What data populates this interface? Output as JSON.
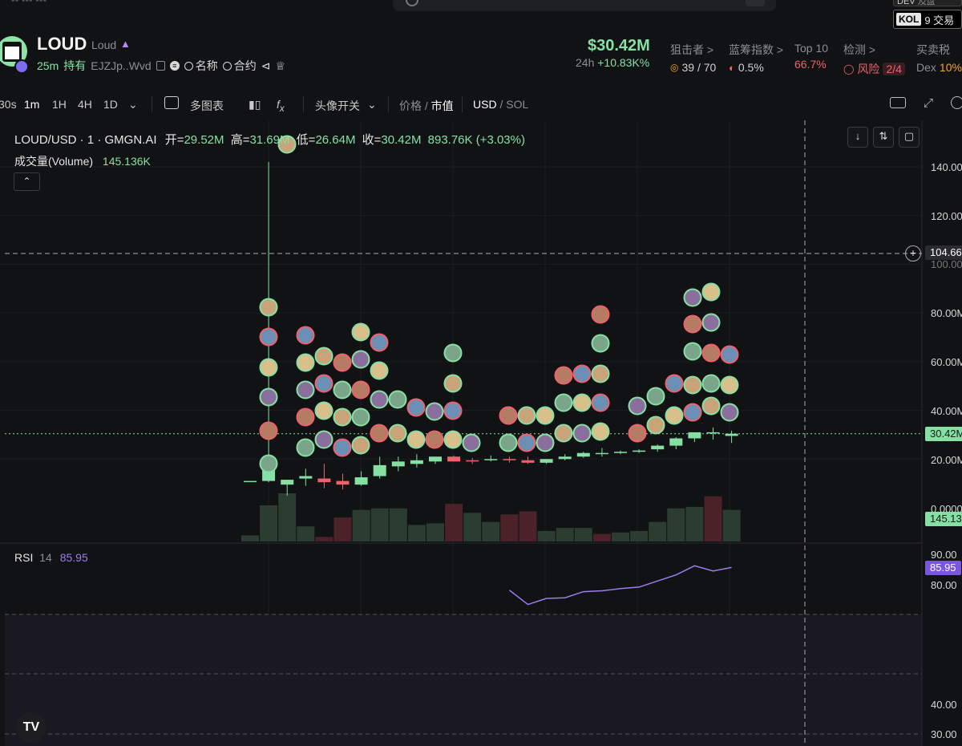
{
  "topbar": {
    "dev_label": "DEV",
    "dev_value": "及盘",
    "kol_label": "KOL",
    "kol_value": "9 交易"
  },
  "token": {
    "symbol": "LOUD",
    "name": "Loud",
    "age": "25m",
    "hold_label": "持有",
    "address": "EJZJp..Wvd",
    "name_search": "名称",
    "contract_search": "合约"
  },
  "market": {
    "price": "$30.42M",
    "period": "24h",
    "change": "+10.83K%"
  },
  "stats": [
    {
      "label": "狙击者 >",
      "value": "39 / 70",
      "color": "#d0d0d0",
      "icon": "sniper-icon"
    },
    {
      "label": "蓝筹指数 >",
      "value": "0.5%",
      "color": "#d0d0d0",
      "icon": "gauge-icon"
    },
    {
      "label": "Top 10",
      "value": "66.7%",
      "color": "#f0616d"
    },
    {
      "label": "检测 >",
      "value": "风险",
      "extra": "2/4",
      "color": "#f0616d",
      "icon": "shield-icon"
    },
    {
      "label": "买卖税",
      "value": "Dex",
      "extra": "10%",
      "color": "#8b8e94"
    }
  ],
  "toolbar": {
    "intervals": [
      "30s",
      "1m",
      "1H",
      "4H",
      "1D"
    ],
    "active_interval": "1m",
    "multi_chart": "多图表",
    "avatar_toggle": "头像开关",
    "price_label": "价格",
    "mcap_label": "市值",
    "usd_label": "USD",
    "sol_label": "SOL"
  },
  "legend": {
    "pair": "LOUD/USD · 1 · GMGN.AI",
    "open_label": "开=",
    "open": "29.52M",
    "high_label": "高=",
    "high": "31.69M",
    "low_label": "低=",
    "low": "26.64M",
    "close_label": "收=",
    "close": "30.42M",
    "change": "893.76K (+3.03%)",
    "volume_label": "成交量(Volume)",
    "volume": "145.136K",
    "rsi_label": "RSI",
    "rsi_period": "14",
    "rsi_value": "85.95"
  },
  "axis": {
    "price_ticks": [
      "140.00M",
      "120.00M",
      "100.00M",
      "80.00M",
      "60.00M",
      "40.00M",
      "20.00M",
      "0.0000"
    ],
    "crosshair_value": "104.66",
    "current_price_tag": "30.42M",
    "volume_tag": "145.13",
    "rsi_ticks": [
      "90.00",
      "80.00",
      "40.00",
      "30.00"
    ],
    "rsi_tag": "85.95"
  },
  "colors": {
    "up": "#86e0a4",
    "down": "#f0616d",
    "rsi": "#9d7cf0",
    "background": "#111214"
  },
  "chart_data": {
    "type": "candlestick",
    "title": "LOUD/USD · 1 · GMGN.AI",
    "unit": "M",
    "candles": [
      {
        "o": 11.0,
        "h": 11.0,
        "l": 11.0,
        "c": 11.0
      },
      {
        "o": 11.0,
        "h": 142.0,
        "l": 10.5,
        "c": 20.5
      },
      {
        "o": 9.5,
        "h": 10.2,
        "l": 5.0,
        "c": 11.5
      },
      {
        "o": 12.0,
        "h": 16.0,
        "l": 9.0,
        "c": 13.0
      },
      {
        "o": 12.0,
        "h": 18.0,
        "l": 8.0,
        "c": 10.5
      },
      {
        "o": 11.0,
        "h": 14.0,
        "l": 7.5,
        "c": 9.5
      },
      {
        "o": 9.5,
        "h": 15.0,
        "l": 9.0,
        "c": 12.5
      },
      {
        "o": 13.0,
        "h": 21.0,
        "l": 12.0,
        "c": 17.5
      },
      {
        "o": 17.0,
        "h": 21.0,
        "l": 15.0,
        "c": 19.0
      },
      {
        "o": 18.0,
        "h": 22.0,
        "l": 16.5,
        "c": 19.5
      },
      {
        "o": 19.0,
        "h": 21.0,
        "l": 18.0,
        "c": 21.0
      },
      {
        "o": 21.0,
        "h": 21.5,
        "l": 19.0,
        "c": 19.0
      },
      {
        "o": 19.5,
        "h": 20.5,
        "l": 18.0,
        "c": 19.0
      },
      {
        "o": 19.5,
        "h": 21.5,
        "l": 19.0,
        "c": 20.0
      },
      {
        "o": 20.0,
        "h": 21.0,
        "l": 18.5,
        "c": 19.5
      },
      {
        "o": 19.5,
        "h": 21.0,
        "l": 18.0,
        "c": 18.5
      },
      {
        "o": 18.5,
        "h": 20.0,
        "l": 18.0,
        "c": 20.0
      },
      {
        "o": 20.0,
        "h": 22.0,
        "l": 19.5,
        "c": 21.0
      },
      {
        "o": 21.0,
        "h": 23.0,
        "l": 20.5,
        "c": 22.5
      },
      {
        "o": 22.5,
        "h": 24.5,
        "l": 21.0,
        "c": 22.5
      },
      {
        "o": 22.5,
        "h": 23.5,
        "l": 22.0,
        "c": 23.0
      },
      {
        "o": 23.0,
        "h": 24.0,
        "l": 22.5,
        "c": 23.5
      },
      {
        "o": 24.0,
        "h": 26.0,
        "l": 23.0,
        "c": 25.5
      },
      {
        "o": 25.5,
        "h": 29.0,
        "l": 24.0,
        "c": 28.5
      },
      {
        "o": 28.5,
        "h": 31.0,
        "l": 27.0,
        "c": 31.0
      },
      {
        "o": 31.0,
        "h": 33.0,
        "l": 28.0,
        "c": 31.0
      },
      {
        "o": 29.5,
        "h": 31.7,
        "l": 26.6,
        "c": 30.4
      }
    ],
    "volume": [
      4,
      24,
      32,
      10,
      3,
      16,
      21,
      22,
      22,
      11,
      12,
      25,
      19,
      13,
      18,
      20,
      7,
      9,
      9,
      5,
      6,
      7,
      13,
      22,
      23,
      30,
      21
    ],
    "volume_up": [
      true,
      true,
      true,
      true,
      false,
      false,
      true,
      true,
      true,
      true,
      true,
      false,
      true,
      true,
      false,
      false,
      true,
      true,
      true,
      false,
      true,
      true,
      true,
      true,
      true,
      false,
      true
    ],
    "rsi": [
      null,
      null,
      null,
      null,
      null,
      null,
      null,
      null,
      null,
      null,
      null,
      null,
      null,
      null,
      78.5,
      73.8,
      75.8,
      76.0,
      78.0,
      78.3,
      79.0,
      79.5,
      81.5,
      83.5,
      86.5,
      84.8,
      85.95
    ],
    "price_range": [
      0,
      145
    ],
    "rsi_range": [
      30,
      90
    ],
    "grid": true
  }
}
